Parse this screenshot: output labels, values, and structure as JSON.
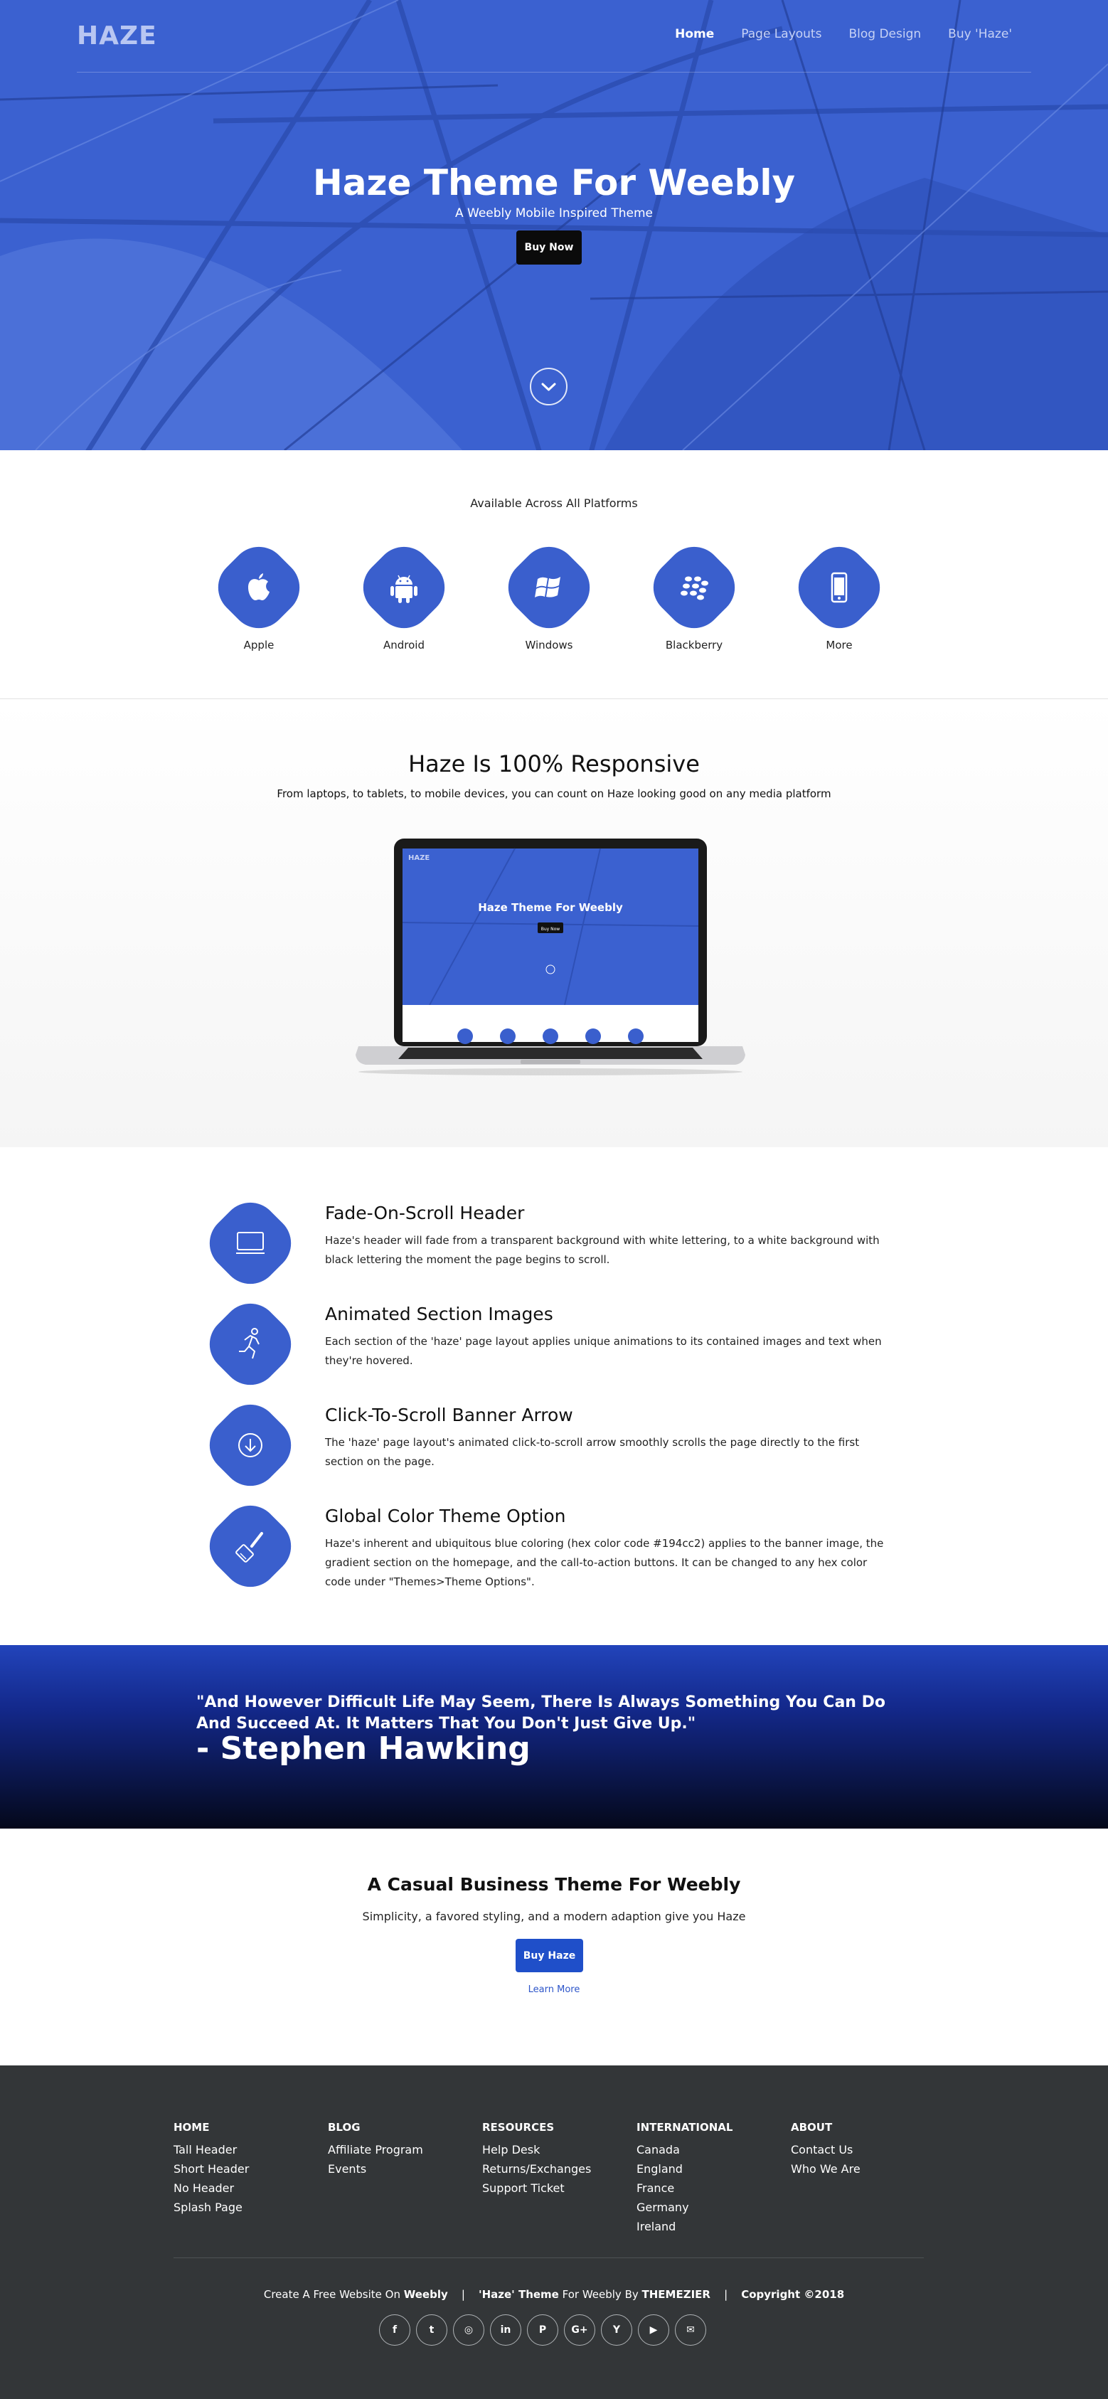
{
  "hero": {
    "logo": "HAZE",
    "nav": [
      "Home",
      "Page Layouts",
      "Blog Design",
      "Buy 'Haze'"
    ],
    "title": "Haze Theme For Weebly",
    "subtitle": "A Weebly Mobile Inspired Theme",
    "button": "Buy Now",
    "scroll_icon": "chevron-down-icon",
    "accent_color": "#3a5fcd"
  },
  "platforms": {
    "caption": "Available Across All Platforms",
    "items": [
      {
        "label": "Apple",
        "icon": "apple-icon"
      },
      {
        "label": "Android",
        "icon": "android-icon"
      },
      {
        "label": "Windows",
        "icon": "windows-icon"
      },
      {
        "label": "Blackberry",
        "icon": "blackberry-icon"
      },
      {
        "label": "More",
        "icon": "phone-icon"
      }
    ]
  },
  "responsive": {
    "title": "Haze Is 100% Responsive",
    "subtitle": "From laptops, to tablets, to mobile devices, you can count on Haze looking good on any media platform",
    "laptop_screen": {
      "logo": "HAZE",
      "title": "Haze Theme For Weebly",
      "button": "Buy Now"
    }
  },
  "features": [
    {
      "title": "Fade-On-Scroll Header",
      "text": "Haze's header will fade from a transparent background with white lettering, to a white background with black lettering the moment the page begins to scroll.",
      "icon": "monitor-icon"
    },
    {
      "title": "Animated Section Images",
      "text": "Each section of the 'haze' page layout applies unique animations to its contained images and text when they're hovered.",
      "icon": "running-person-icon"
    },
    {
      "title": "Click-To-Scroll Banner Arrow",
      "text": "The 'haze' page layout's animated click-to-scroll arrow smoothly scrolls the page directly to the first section on the page.",
      "icon": "arrow-down-circle-icon"
    },
    {
      "title": "Global Color Theme Option",
      "text": "Haze's inherent and ubiquitous blue coloring (hex color code #194cc2) applies to the banner image, the gradient section on the homepage, and the call-to-action buttons. It can be changed to any hex color code under \"Themes>Theme Options\".",
      "icon": "paintbrush-icon"
    }
  ],
  "quote": {
    "text": "\"And However Difficult Life May Seem, There Is Always Something You Can Do And Succeed At. It Matters That You Don't Just Give Up.\"",
    "author": "- Stephen Hawking"
  },
  "cta": {
    "title": "A Casual Business Theme For Weebly",
    "subtitle": "Simplicity, a favored styling, and a modern adaption give you Haze",
    "button": "Buy Haze",
    "link": "Learn More",
    "button_color": "#1f4fc9"
  },
  "footer": {
    "columns": [
      {
        "heading": "HOME",
        "links": [
          "Tall Header",
          "Short Header",
          "No Header",
          "Splash Page"
        ]
      },
      {
        "heading": "BLOG",
        "links": [
          "Affiliate Program",
          "Events"
        ]
      },
      {
        "heading": "RESOURCES",
        "links": [
          "Help Desk",
          "Returns/Exchanges",
          "Support Ticket"
        ]
      },
      {
        "heading": "INTERNATIONAL",
        "links": [
          "Canada",
          "England",
          "France",
          "Germany",
          "Ireland"
        ]
      },
      {
        "heading": "ABOUT",
        "links": [
          "Contact Us",
          "Who We Are"
        ]
      }
    ],
    "credit": {
      "part1": "Create A Free Website On ",
      "weebly": "Weebly",
      "sep1": "|",
      "haze": "'Haze' Theme",
      "part2": " For Weebly By ",
      "themezier": "THEMEZIER",
      "sep2": "|",
      "copyright": "Copyright ©2018"
    },
    "social": [
      {
        "icon": "facebook-icon",
        "glyph": "f"
      },
      {
        "icon": "twitter-icon",
        "glyph": "t"
      },
      {
        "icon": "instagram-icon",
        "glyph": "◎"
      },
      {
        "icon": "linkedin-icon",
        "glyph": "in"
      },
      {
        "icon": "pinterest-icon",
        "glyph": "P"
      },
      {
        "icon": "google-plus-icon",
        "glyph": "G+"
      },
      {
        "icon": "yelp-icon",
        "glyph": "Y"
      },
      {
        "icon": "youtube-icon",
        "glyph": "▶"
      },
      {
        "icon": "email-icon",
        "glyph": "✉"
      }
    ]
  }
}
